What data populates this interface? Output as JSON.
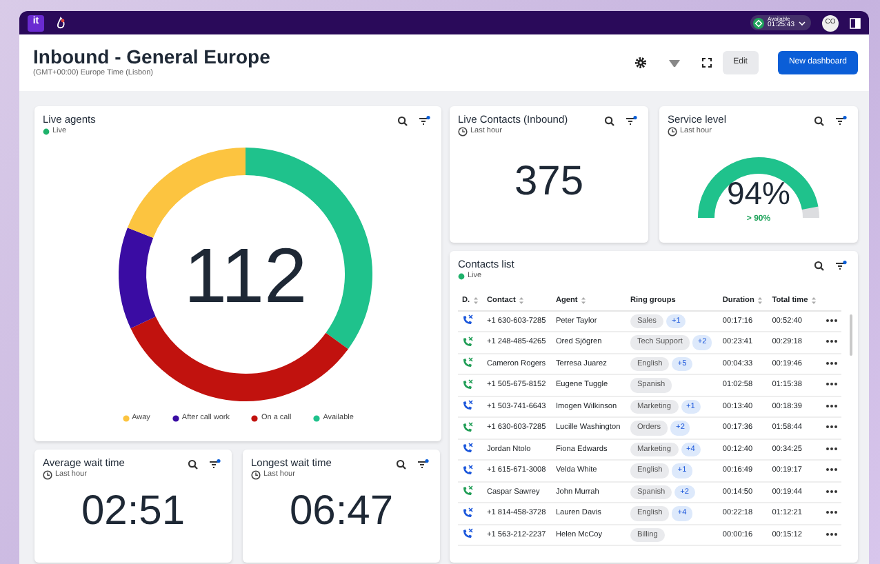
{
  "topbar": {
    "logo": "it",
    "status": {
      "label": "Available",
      "timer": "01:25:43"
    },
    "avatar": "CO"
  },
  "header": {
    "title": "Inbound - General Europe",
    "subtitle": "(GMT+00:00) Europe Time (Lisbon)",
    "buttons": [
      {
        "label": "Edit",
        "kind": "secondary"
      },
      {
        "label": "New dashboard",
        "kind": "primary"
      }
    ]
  },
  "live_agents": {
    "title": "Live agents",
    "subtitle": "Live",
    "total": "112",
    "legend": [
      {
        "label": "Away",
        "color": "#fcc440"
      },
      {
        "label": "After call work",
        "color": "#3a0ca3"
      },
      {
        "label": "On a call",
        "color": "#c1120e"
      },
      {
        "label": "Available",
        "color": "#1fc28c"
      }
    ]
  },
  "live_contacts": {
    "title": "Live Contacts (Inbound)",
    "subtitle": "Last hour",
    "value": "375"
  },
  "service_level": {
    "title": "Service level",
    "subtitle": "Last hour",
    "value": "94%",
    "target": "> 90%"
  },
  "avg_wait": {
    "title": "Average wait time",
    "subtitle": "Last hour",
    "value": "02:51"
  },
  "longest_wait": {
    "title": "Longest wait time",
    "subtitle": "Last hour",
    "value": "06:47"
  },
  "contacts_list": {
    "title": "Contacts list",
    "subtitle": "Live",
    "columns": [
      "D.",
      "Contact",
      "Agent",
      "Ring groups",
      "Duration",
      "Total time"
    ],
    "rows": [
      {
        "color": "#1a56db",
        "contact": "+1 630-603-7285",
        "agent": "Peter Taylor",
        "group": "Sales",
        "extra": "+1",
        "duration": "00:17:16",
        "total": "00:52:40"
      },
      {
        "color": "#1f9d55",
        "contact": "+1 248-485-4265",
        "agent": "Ored Sjögren",
        "group": "Tech Support",
        "extra": "+2",
        "duration": "00:23:41",
        "total": "00:29:18"
      },
      {
        "color": "#1f9d55",
        "contact": "Cameron Rogers",
        "agent": "Terresa Juarez",
        "group": "English",
        "extra": "+5",
        "duration": "00:04:33",
        "total": "00:19:46"
      },
      {
        "color": "#1f9d55",
        "contact": "+1 505-675-8152",
        "agent": "Eugene Tuggle",
        "group": "Spanish",
        "duration": "01:02:58",
        "total": "01:15:38"
      },
      {
        "color": "#1a56db",
        "contact": "+1 503-741-6643",
        "agent": "Imogen Wilkinson",
        "group": "Marketing",
        "extra": "+1",
        "duration": "00:13:40",
        "total": "00:18:39"
      },
      {
        "color": "#1f9d55",
        "contact": "+1 630-603-7285",
        "agent": "Lucille Washington",
        "group": "Orders",
        "extra": "+2",
        "duration": "00:17:36",
        "total": "01:58:44"
      },
      {
        "color": "#1a56db",
        "contact": "Jordan Ntolo",
        "agent": "Fiona Edwards",
        "group": "Marketing",
        "extra": "+4",
        "duration": "00:12:40",
        "total": "00:34:25"
      },
      {
        "color": "#1a56db",
        "contact": "+1 615-671-3008",
        "agent": "Velda White",
        "group": "English",
        "extra": "+1",
        "duration": "00:16:49",
        "total": "00:19:17"
      },
      {
        "color": "#1f9d55",
        "contact": "Caspar Sawrey",
        "agent": "John Murrah",
        "group": "Spanish",
        "extra": "+2",
        "duration": "00:14:50",
        "total": "00:19:44"
      },
      {
        "color": "#1a56db",
        "contact": "+1 814-458-3728",
        "agent": "Lauren Davis",
        "group": "English",
        "extra": "+4",
        "duration": "00:22:18",
        "total": "01:12:21"
      },
      {
        "color": "#1a56db",
        "contact": "+1 563-212-2237",
        "agent": "Helen McCoy",
        "group": "Billing",
        "duration": "00:00:16",
        "total": "00:15:12"
      }
    ]
  }
}
